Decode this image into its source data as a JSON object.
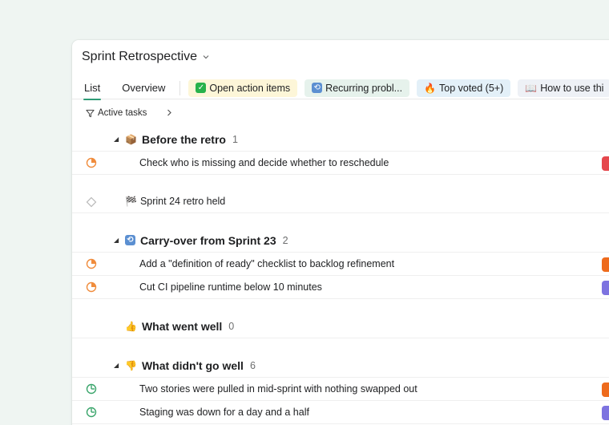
{
  "project": {
    "title": "Sprint Retrospective"
  },
  "tabs": {
    "list": "List",
    "overview": "Overview",
    "chips": [
      {
        "icon": "check-box-emoji",
        "label": "Open action items",
        "color": "#fdf6d8"
      },
      {
        "icon": "repeat-emoji",
        "label": "Recurring probl...",
        "color": "#e6f2ec"
      },
      {
        "icon": "fire-emoji",
        "label": "Top voted (5+)",
        "color": "#e3f0f8"
      },
      {
        "icon": "book-emoji",
        "label": "How to use thi",
        "color": "#eef1f6"
      }
    ]
  },
  "filter": {
    "label": "Active tasks"
  },
  "sections": [
    {
      "title": "Before the retro",
      "count": "1",
      "emoji": "📦",
      "tasks": [
        {
          "text": "Check who is missing and decide whether to reschedule",
          "status": "in-progress",
          "tag_color": "#e5484d"
        }
      ]
    },
    {
      "milestone": {
        "text": "Sprint 24 retro held",
        "emoji": "🏁"
      }
    },
    {
      "title": "Carry-over from Sprint 23",
      "count": "2",
      "emoji": "🔁",
      "tasks": [
        {
          "text": "Add a \"definition of ready\" checklist to backlog refinement",
          "status": "in-progress",
          "tag_color": "#ee6b1d"
        },
        {
          "text": "Cut CI pipeline runtime below 10 minutes",
          "status": "in-progress",
          "tag_color": "#7d73e0"
        }
      ]
    },
    {
      "title": "What went well",
      "count": "0",
      "emoji": "👍"
    },
    {
      "title": "What didn't go well",
      "count": "6",
      "emoji": "👎",
      "tasks": [
        {
          "text": "Two stories were pulled in mid-sprint with nothing swapped out",
          "status": "open",
          "tag_color": "#ee6b1d"
        },
        {
          "text": "Staging was down for a day and a half",
          "status": "open",
          "tag_color": "#7d73e0"
        }
      ]
    }
  ],
  "colors": {
    "accent": "#2e9b76",
    "status_in_progress": "#f08c3c",
    "status_open": "#3aa56b"
  }
}
